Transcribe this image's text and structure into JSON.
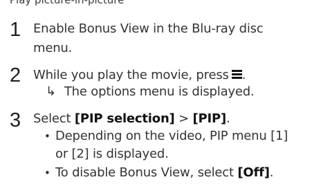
{
  "header_partial": "Play picture-in-picture",
  "steps": [
    {
      "number": "1",
      "lines": [
        "Enable Bonus View in the Blu-ray disc",
        "menu."
      ]
    },
    {
      "number": "2",
      "text": "While you play the movie, press",
      "icon": "menu-icon",
      "result_arrow": "↳",
      "result": "The options menu is displayed."
    },
    {
      "number": "3",
      "text_bold_1": "[PIP selection]",
      "sep": " > ",
      "text_bold_2": "[PIP]",
      "text_end": ".",
      "bullets": [
        {
          "lines": [
            "Depending on the video, PIP menu [1]",
            "or [2] is displayed."
          ]
        },
        {
          "text": "To disable Bonus View, select ",
          "bold": "[Off]",
          "end": "."
        }
      ]
    }
  ],
  "select_word": "Select "
}
